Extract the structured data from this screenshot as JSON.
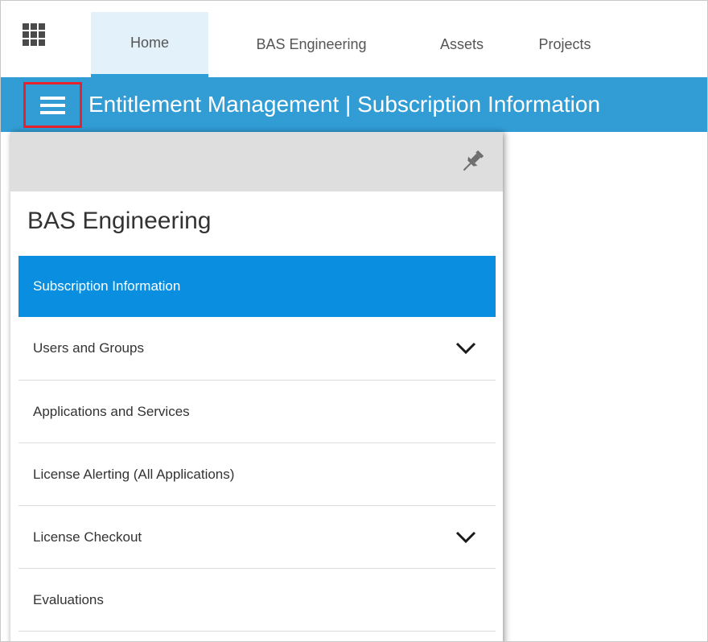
{
  "topnav": {
    "launcher_icon": "app-grid-icon",
    "tabs": [
      {
        "label": "Home",
        "active": true
      },
      {
        "label": "BAS Engineering",
        "active": false
      },
      {
        "label": "Assets",
        "active": false
      },
      {
        "label": "Projects",
        "active": false
      }
    ]
  },
  "titlebar": {
    "menu_icon": "hamburger-menu-icon",
    "title": "Entitlement Management | Subscription Information"
  },
  "sidepanel": {
    "pin_icon": "pin-icon",
    "title": "BAS Engineering",
    "items": [
      {
        "label": "Subscription Information",
        "selected": true,
        "expandable": false
      },
      {
        "label": "Users and Groups",
        "selected": false,
        "expandable": true
      },
      {
        "label": "Applications and Services",
        "selected": false,
        "expandable": false
      },
      {
        "label": "License Alerting (All Applications)",
        "selected": false,
        "expandable": false
      },
      {
        "label": "License Checkout",
        "selected": false,
        "expandable": true
      },
      {
        "label": "Evaluations",
        "selected": false,
        "expandable": false
      }
    ]
  },
  "colors": {
    "titlebar": "#329dd5",
    "selected_item": "#0a8fe0",
    "active_tab": "#e3f1fb",
    "highlight_box": "#e8222d"
  }
}
